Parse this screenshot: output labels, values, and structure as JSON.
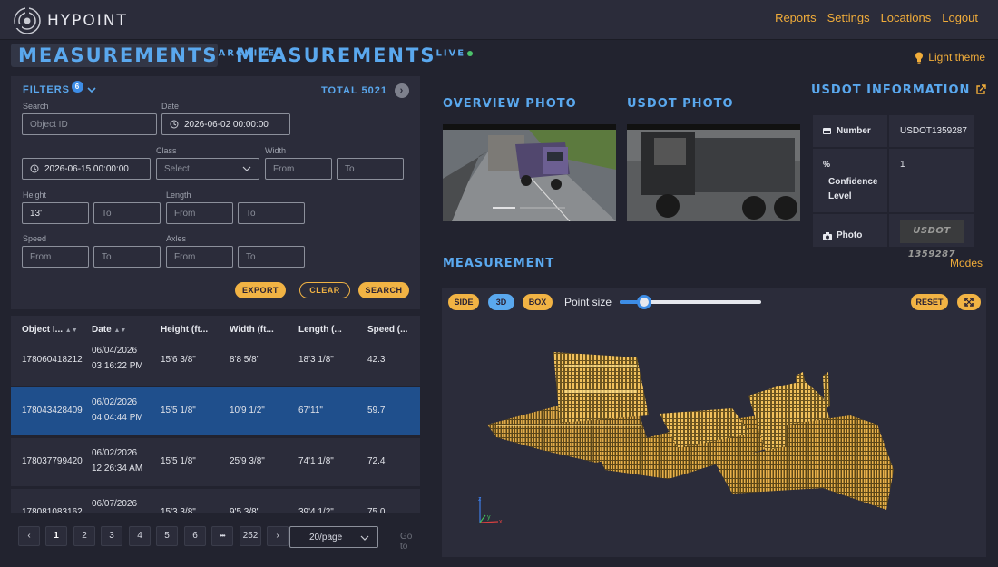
{
  "app": {
    "logo_text": "HYPOINT"
  },
  "nav": [
    "Reports",
    "Settings",
    "Locations",
    "Logout"
  ],
  "tabs": {
    "archive": {
      "title": "MEASUREMENTS",
      "sup": "ARCHIVE"
    },
    "live": {
      "title": "MEASUREMENTS",
      "sup": "LIVE"
    }
  },
  "theme_toggle": "Light theme",
  "filters": {
    "title": "FILTERS",
    "count": "6",
    "total": "TOTAL 5021",
    "search_label": "Search",
    "search_placeholder": "Object ID",
    "date_label": "Date",
    "date_from": "2026-06-02 00:00:00",
    "date_to": "2026-06-15 00:00:00",
    "class_label": "Class",
    "class_placeholder": "Select",
    "width_label": "Width",
    "height_label": "Height",
    "height_from": "13'",
    "length_label": "Length",
    "speed_label": "Speed",
    "axles_label": "Axles",
    "from": "From",
    "to": "To",
    "export": "EXPORT",
    "clear": "CLEAR",
    "search": "SEARCH"
  },
  "table": {
    "columns": [
      "Object I...",
      "Date",
      "Height (ft...",
      "Width (ft...",
      "Length (...",
      "Speed (..."
    ],
    "rows": [
      {
        "id": "178060418212",
        "date": "06/04/2026",
        "time": "03:16:22 PM",
        "height": "15'6 3/8\"",
        "width": "8'8 5/8\"",
        "length": "18'3 1/8\"",
        "speed": "42.3"
      },
      {
        "id": "178043428409",
        "date": "06/02/2026",
        "time": "04:04:44 PM",
        "height": "15'5 1/8\"",
        "width": "10'9 1/2\"",
        "length": "67'11\"",
        "speed": "59.7"
      },
      {
        "id": "178037799420",
        "date": "06/02/2026",
        "time": "12:26:34 AM",
        "height": "15'5 1/8\"",
        "width": "25'9 3/8\"",
        "length": "74'1 1/8\"",
        "speed": "72.4"
      },
      {
        "id": "178081083162",
        "date": "06/07/2026",
        "time": "",
        "height": "15'3 3/8\"",
        "width": "9'5 3/8\"",
        "length": "39'4 1/2\"",
        "speed": "75.0"
      }
    ]
  },
  "pagination": {
    "prev": "‹",
    "next": "›",
    "pages": [
      "1",
      "2",
      "3",
      "4",
      "5",
      "6"
    ],
    "ellipsis": "•••",
    "last": "252",
    "per_page": "20/page",
    "goto": "Go to"
  },
  "sections": {
    "overview_photo": "OVERVIEW PHOTO",
    "usdot_photo": "USDOT PHOTO",
    "usdot_info": "USDOT INFORMATION",
    "measurement": "MEASUREMENT",
    "modes": "Modes"
  },
  "usdot": {
    "number_label": "Number",
    "number_value": "USDOT1359287",
    "confidence_label": "Confidence Level",
    "confidence_value": "1",
    "photo_label": "Photo",
    "plate_text": "USDOT 1359287"
  },
  "viewer": {
    "side": "SIDE",
    "three_d": "3D",
    "box": "BOX",
    "point_size_label": "Point size",
    "point_size_value": 0.17,
    "reset": "RESET"
  },
  "colors": {
    "accent_blue": "#5aa8ee",
    "accent_orange": "#f0ac3a",
    "point_cloud": "#e8b04a"
  }
}
